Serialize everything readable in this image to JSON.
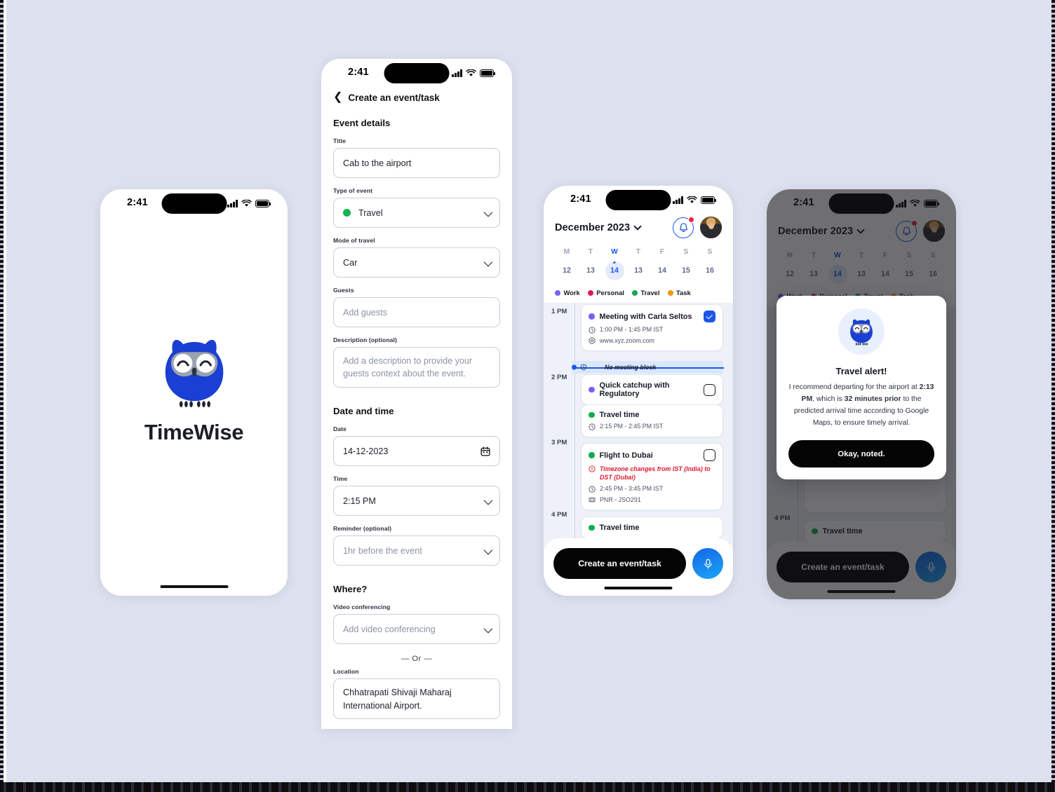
{
  "app": {
    "name": "TimeWise",
    "brand_color": "#1a3fd4",
    "accent_blue": "#1a56e8"
  },
  "status_bar": {
    "time": "2:41",
    "signal_icon": "cellular-bars-icon",
    "wifi_icon": "wifi-icon",
    "battery_icon": "battery-full-icon"
  },
  "splash": {
    "logo_icon": "owl-logo-icon",
    "title": "TimeWise"
  },
  "form": {
    "back_icon": "chevron-left-icon",
    "header_title": "Create an event/task",
    "sections": [
      {
        "title": "Event details"
      },
      {
        "title": "Date and time"
      },
      {
        "title": "Where?"
      }
    ],
    "fields": {
      "title": {
        "label": "Title",
        "value": "Cab to the airport"
      },
      "type_of_event": {
        "label": "Type of event",
        "value": "Travel",
        "dot_color": "#14b352",
        "chevron_icon": "chevron-down-icon"
      },
      "mode_of_travel": {
        "label": "Mode of travel",
        "value": "Car",
        "chevron_icon": "chevron-down-icon"
      },
      "guests": {
        "label": "Guests",
        "placeholder": "Add guests"
      },
      "description": {
        "label": "Description (optional)",
        "placeholder": "Add a description to provide your guests context about the event."
      },
      "date": {
        "label": "Date",
        "value": "14-12-2023",
        "icon": "calendar-icon"
      },
      "time": {
        "label": "Time",
        "value": "2:15 PM",
        "chevron_icon": "chevron-down-icon"
      },
      "reminder": {
        "label": "Reminder (optional)",
        "placeholder": "1hr before the event",
        "chevron_icon": "chevron-down-icon"
      },
      "video_conferencing": {
        "label": "Video conferencing",
        "placeholder": "Add video conferencing",
        "chevron_icon": "chevron-down-icon"
      },
      "or_divider": "— Or —",
      "location": {
        "label": "Location",
        "value": "Chhatrapati Shivaji Maharaj International Airport."
      }
    }
  },
  "calendar": {
    "month_label": "December 2023",
    "month_chevron_icon": "chevron-down-icon",
    "bell_icon": "bell-icon",
    "has_notification_badge": true,
    "avatar_icon": "user-avatar",
    "week": [
      {
        "dow": "M",
        "day": "12",
        "active": false
      },
      {
        "dow": "T",
        "day": "13",
        "active": false
      },
      {
        "dow": "W",
        "day": "14",
        "active": true
      },
      {
        "dow": "T",
        "day": "13",
        "active": false
      },
      {
        "dow": "F",
        "day": "14",
        "active": false
      },
      {
        "dow": "S",
        "day": "15",
        "active": false
      },
      {
        "dow": "S",
        "day": "16",
        "active": false
      }
    ],
    "legend": [
      {
        "label": "Work",
        "color": "#7b61f5"
      },
      {
        "label": "Personal",
        "color": "#e01a5a"
      },
      {
        "label": "Travel",
        "color": "#0fab4e"
      },
      {
        "label": "Task",
        "color": "#f2950d"
      }
    ],
    "hours": [
      "1 PM",
      "2 PM",
      "3 PM",
      "4 PM"
    ],
    "now_marker": {
      "label": "No meeting block",
      "icon": "shield-clock-icon",
      "struck_through": true
    },
    "events": [
      {
        "title": "Meeting with Carla Seltos",
        "dot_color": "#7b61f5",
        "checked": true,
        "meta": [
          {
            "icon": "clock-icon",
            "text": "1:00 PM - 1:45 PM IST"
          },
          {
            "icon": "link-icon",
            "text": "www.xyz.zoom.com"
          }
        ]
      },
      {
        "title": "Quick catchup with Regulatory",
        "dot_color": "#7b61f5",
        "checked": false,
        "meta": []
      },
      {
        "title": "Travel time",
        "dot_color": "#0fab4e",
        "checked": false,
        "meta": [
          {
            "icon": "clock-icon",
            "text": "2:15 PM - 2:45 PM IST"
          }
        ]
      },
      {
        "title": "Flight to Dubai",
        "dot_color": "#0fab4e",
        "checked": false,
        "warning": {
          "icon": "alert-clock-icon",
          "text": "Timezone changes from IST (India) to DST (Dubai)"
        },
        "meta": [
          {
            "icon": "clock-icon",
            "text": "2:45 PM - 3:45 PM IST"
          },
          {
            "icon": "ticket-icon",
            "text": "PNR - JSO291"
          }
        ]
      },
      {
        "title": "Travel time",
        "dot_color": "#0fab4e",
        "checked": false,
        "meta": []
      }
    ],
    "footer": {
      "cta_label": "Create an event/task",
      "mic_icon": "microphone-icon"
    }
  },
  "alert_modal": {
    "owl_icon": "owl-logo-icon",
    "title": "Travel alert!",
    "body_part_1": "I recommend departing for the airport at ",
    "body_bold_1": "2:13 PM",
    "body_part_2": ", which is ",
    "body_bold_2": "32 minutes prior",
    "body_part_3": " to the predicted arrival time according to Google Maps, to ensure timely arrival.",
    "button_label": "Okay, noted."
  }
}
